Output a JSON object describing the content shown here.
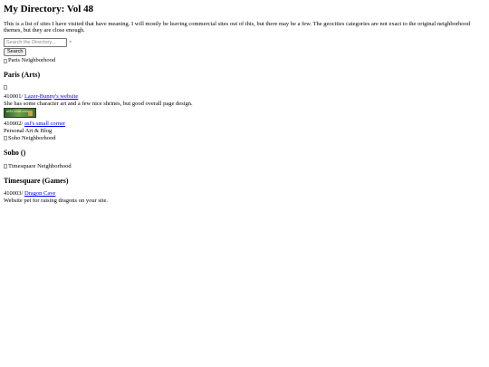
{
  "page": {
    "title": "My Directory: Vol 48",
    "intro": "This is a list of sites I have visited that have meaning. I will mostly be leaving commercial sites out of this, but there may be a few. The geocities categories are not exact to the original neighborhood themes, but they are close enough."
  },
  "search": {
    "placeholder": "Search the Directory...",
    "value": "",
    "clear_glyph": "×",
    "button_label": "Search"
  },
  "sections": [
    {
      "banner_alt": "Paris Neighborhood",
      "heading": "Paris (Arts)",
      "entries": [
        {
          "code": "410001/",
          "link": "Lazer-Bunny's website",
          "description": "She has some character art and a few nice shrines, but good overall page design."
        },
        {
          "banner_text": "asf's small corner",
          "code": "410002/",
          "link": "asf's small corner",
          "description": "Personal Art & Blog"
        }
      ]
    },
    {
      "banner_alt": "Soho Neighborhood",
      "heading": "Soho ()",
      "entries": []
    },
    {
      "banner_alt": "Timesquare Neighborhood",
      "heading": "Timesquare (Games)",
      "entries": [
        {
          "code": "410003/",
          "link": "Dragon Cave",
          "description": "Website pet for raising dragons on your site."
        }
      ]
    }
  ],
  "colors": {
    "link": "#0000ee",
    "text": "#000000",
    "background": "#ffffff"
  }
}
